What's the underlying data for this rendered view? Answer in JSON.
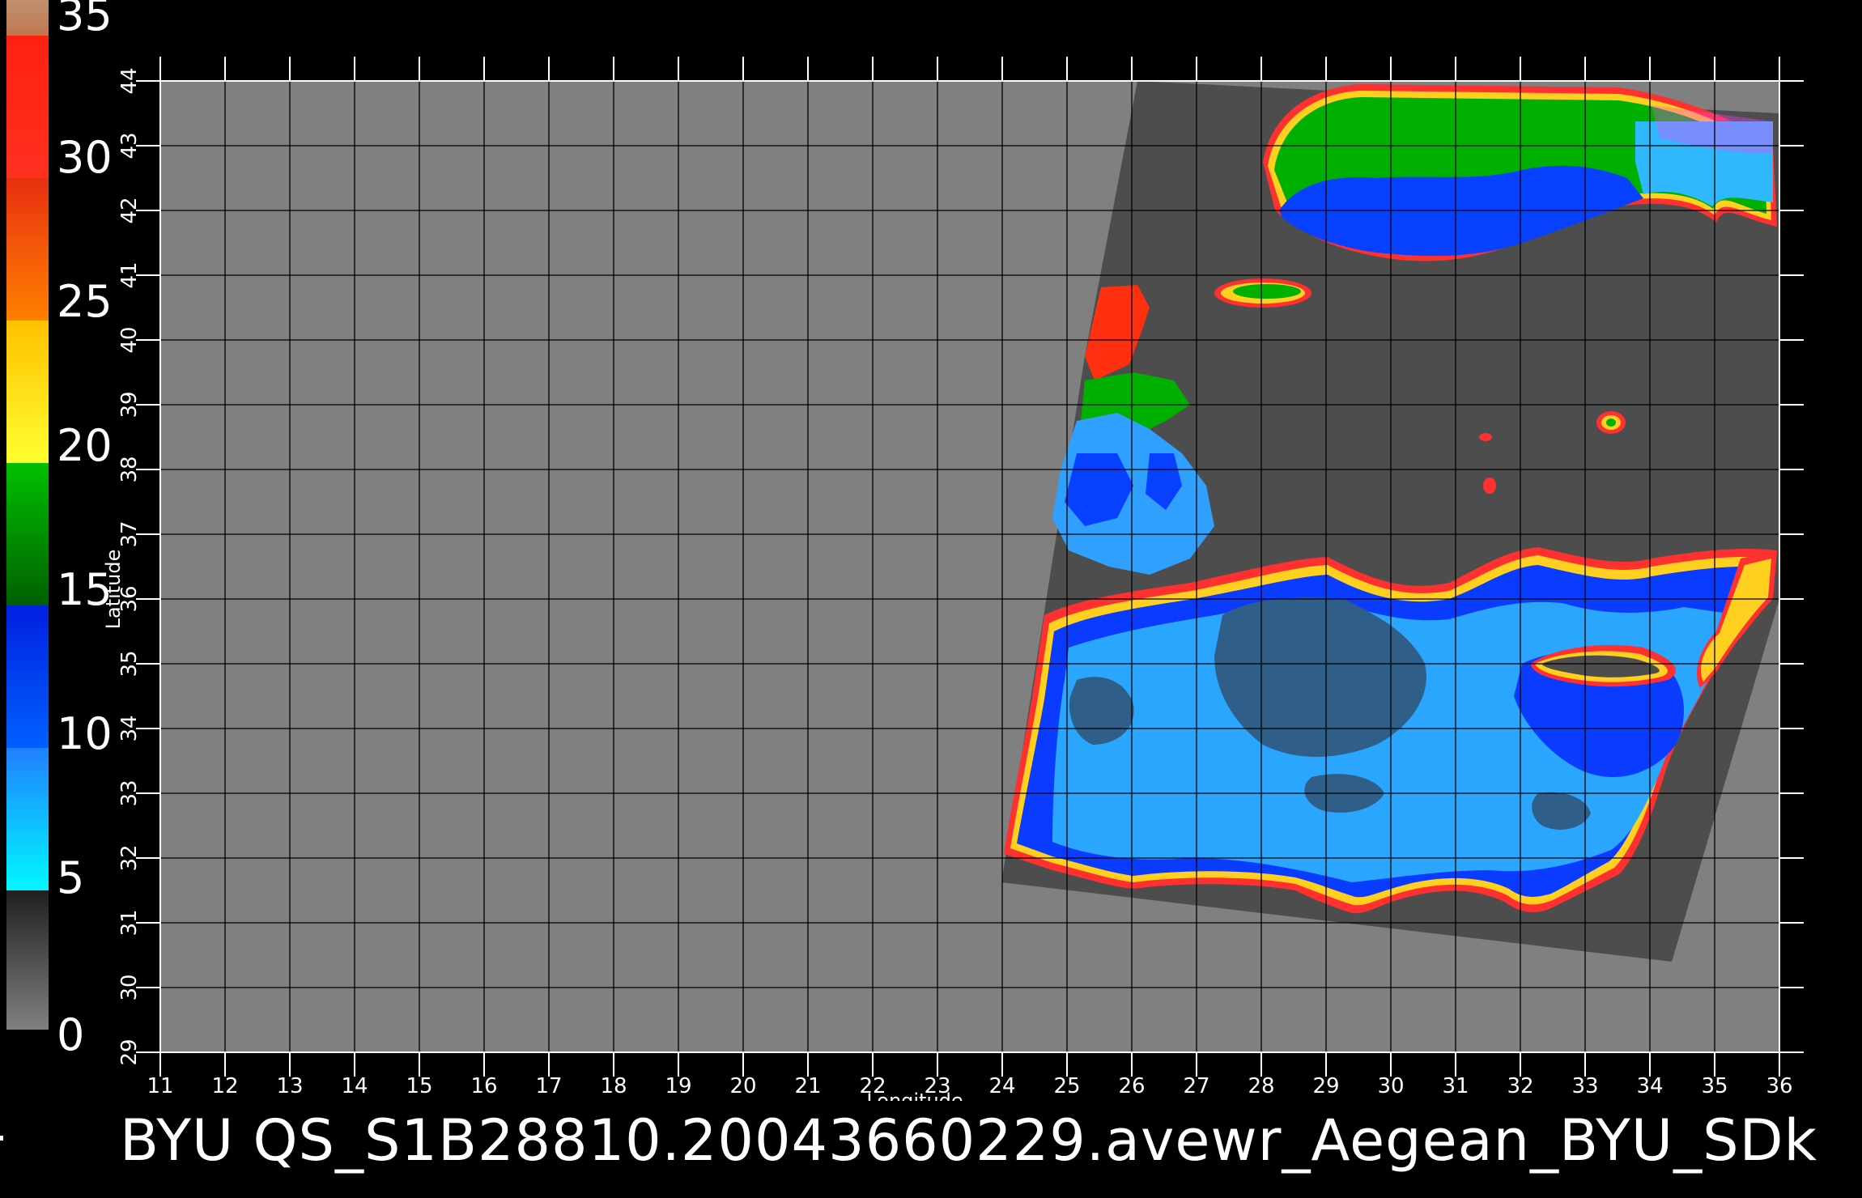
{
  "colorbar": {
    "labels": [
      "35",
      "30",
      "25",
      "20",
      "15",
      "10",
      "5",
      "0"
    ],
    "colors": {
      "c35": "#c07850",
      "c30": "#ff2010",
      "c25": "#ff8000",
      "c20": "#ffe000",
      "c15": "#00a000",
      "c10": "#0040ff",
      "c5": "#00e0ff",
      "c0": "#505050"
    }
  },
  "map": {
    "xlabel": "Longitude",
    "ylabel": "Latitude",
    "lon_ticks": [
      "11",
      "12",
      "13",
      "14",
      "15",
      "16",
      "17",
      "18",
      "19",
      "20",
      "21",
      "22",
      "23",
      "24",
      "25",
      "26",
      "27",
      "28",
      "29",
      "30",
      "31",
      "32",
      "33",
      "34",
      "35",
      "36"
    ],
    "lat_ticks": [
      "29",
      "30",
      "31",
      "32",
      "33",
      "34",
      "35",
      "36",
      "37",
      "38",
      "39",
      "40",
      "41",
      "42",
      "43",
      "44"
    ],
    "background_color": "#808080",
    "swath_color": "#4d4d4d"
  },
  "footer": {
    "title": "BYU  QS_S1B28810.20043660229.avewr_Aegean_BYU_SDk"
  }
}
